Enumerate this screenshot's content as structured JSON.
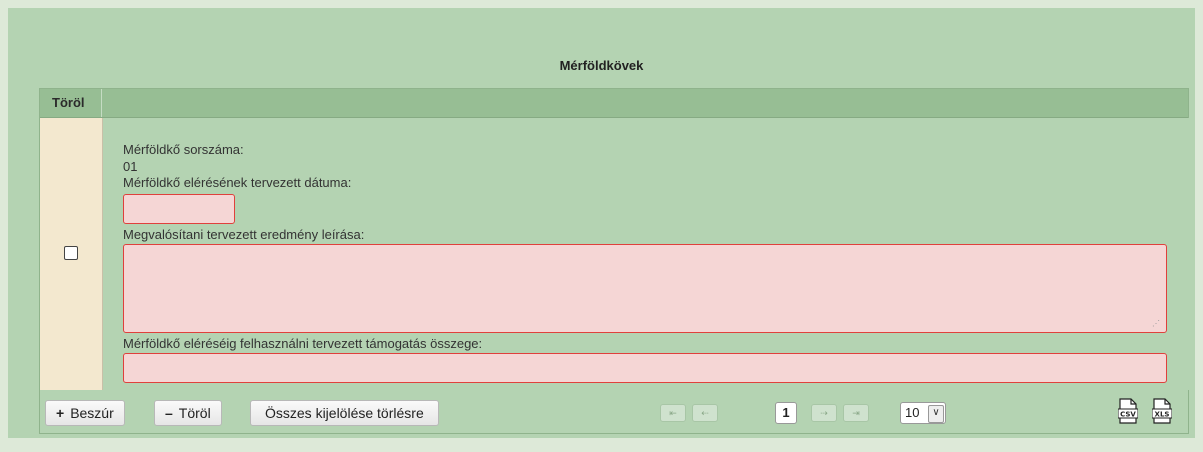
{
  "panel": {
    "title": "Mérföldkövek"
  },
  "grid": {
    "header": {
      "delete_col": "Töröl"
    },
    "row": {
      "milestone_number_label": "Mérföldkő sorszáma:",
      "milestone_number_value": "01",
      "planned_date_label": "Mérföldkő elérésének tervezett dátuma:",
      "planned_date_value": "",
      "planned_result_label": "Megvalósítani tervezett eredmény leírása:",
      "planned_result_value": "",
      "planned_support_label": "Mérföldkő eléréséig felhasználni tervezett támogatás összege:",
      "planned_support_value": ""
    }
  },
  "footer": {
    "insert_label": "Beszúr",
    "insert_symbol": "+",
    "delete_label": "Töröl",
    "delete_symbol": "–",
    "clear_selection_label": "Összes kijelölése törlésre",
    "pager": {
      "first": "⇤",
      "prev": "⇠",
      "current_page": "1",
      "next": "⇢",
      "last": "⇥",
      "page_size": "10"
    },
    "export": {
      "csv_label": "CSV",
      "xls_label": "XLS"
    }
  },
  "colors": {
    "background": "#dde9d8",
    "panel": "#b4d3b2",
    "header": "#97be94",
    "checkbox_cell": "#f3e8cf",
    "field_bg": "#f5d6d5",
    "field_border": "#e0403c"
  }
}
